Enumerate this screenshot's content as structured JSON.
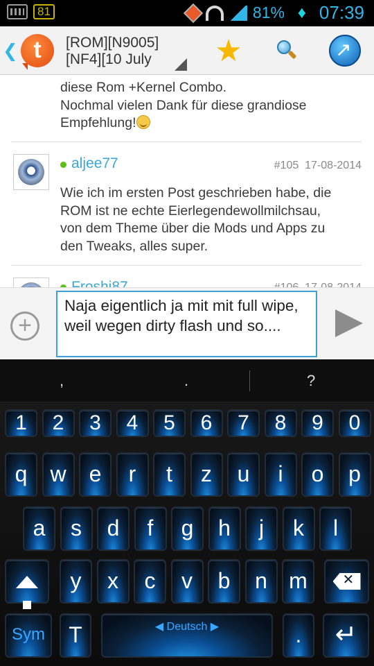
{
  "status_bar": {
    "battery_badge": "81",
    "battery_percent": "81%",
    "time": "07:39"
  },
  "app_bar": {
    "thread_title_line1": "[ROM][N9005]",
    "thread_title_line2": "[NF4][10 July"
  },
  "posts": [
    {
      "text_lines": [
        "diese Rom +Kernel Combo.",
        "Nochmal vielen Dank für diese grandiose",
        "Empfehlung!"
      ]
    },
    {
      "username": "aljee77",
      "number": "#105",
      "date": "17-08-2014",
      "text_lines": [
        "Wie ich im ersten Post geschrieben habe, die",
        "ROM ist ne echte Eierlegendewollmilchsau,",
        "von dem Theme über die Mods und Apps zu",
        "den Tweaks, alles super."
      ]
    },
    {
      "username": "Froshi87",
      "number": "#106",
      "date": "17-08-2014"
    }
  ],
  "compose": {
    "text": "Naja eigentlich ja mit mit full wipe, weil wegen dirty flash und so...."
  },
  "keyboard": {
    "suggestions": [
      ",",
      ".",
      "?"
    ],
    "row_numbers": [
      "1",
      "2",
      "3",
      "4",
      "5",
      "6",
      "7",
      "8",
      "9",
      "0"
    ],
    "row_top": [
      "q",
      "w",
      "e",
      "r",
      "t",
      "z",
      "u",
      "i",
      "o",
      "p"
    ],
    "row_middle": [
      "a",
      "s",
      "d",
      "f",
      "g",
      "h",
      "j",
      "k",
      "l"
    ],
    "row_bottom": [
      "y",
      "x",
      "c",
      "v",
      "b",
      "n",
      "m"
    ],
    "sym_label": "Sym",
    "text_tool_label": "T",
    "space_label": "Deutsch",
    "punct_key_label": ".",
    "punct_key_hint": "?"
  }
}
